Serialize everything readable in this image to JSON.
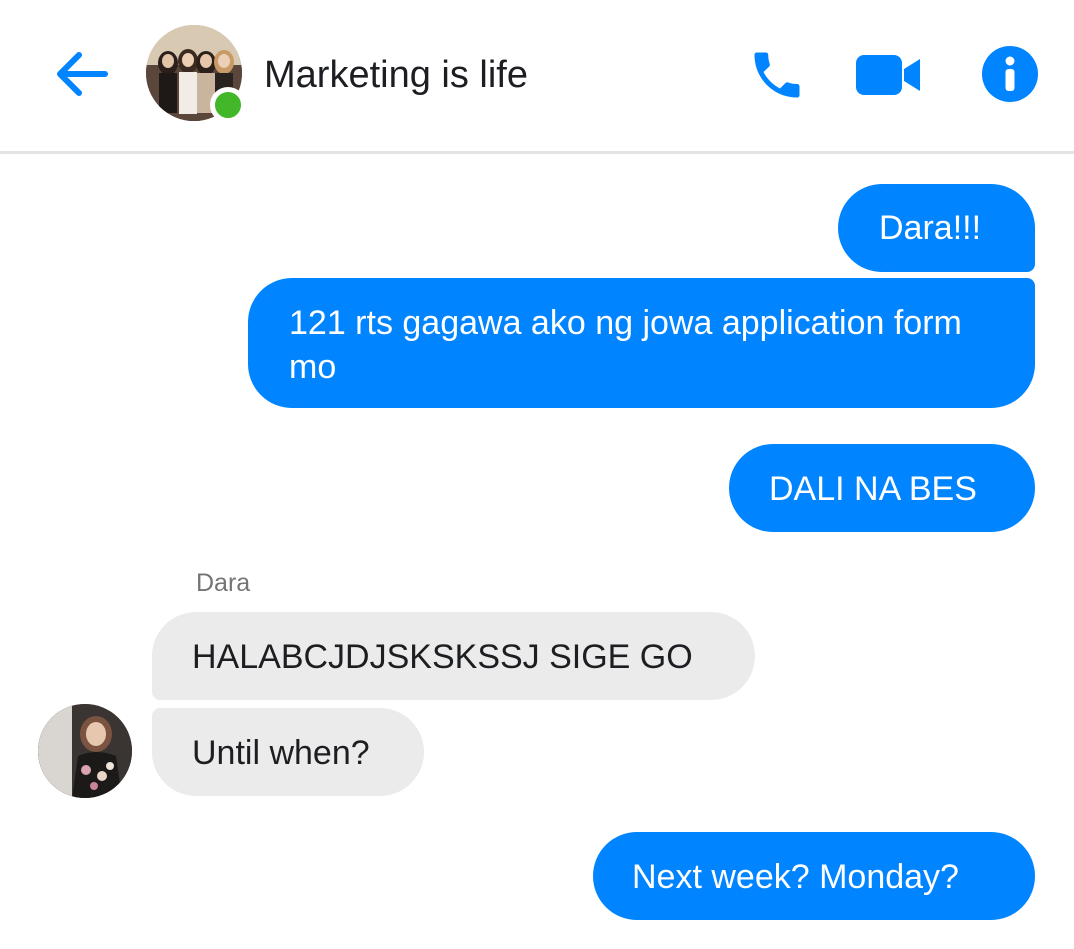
{
  "header": {
    "back_icon": "arrow-left-icon",
    "title": "Marketing is life",
    "online": true,
    "call_icon": "phone-icon",
    "video_icon": "video-camera-icon",
    "info_icon": "info-icon",
    "accent_color": "#0084ff",
    "presence_color": "#42b72a"
  },
  "messages": [
    {
      "direction": "outgoing",
      "text": "Dara!!!"
    },
    {
      "direction": "outgoing",
      "text": "121 rts gagawa ako ng jowa application form mo"
    },
    {
      "direction": "outgoing",
      "text": "DALI NA BES"
    },
    {
      "direction": "incoming",
      "sender": "Dara",
      "text": "HALABCJDJSKSKSSJ SIGE GO"
    },
    {
      "direction": "incoming",
      "sender": "Dara",
      "text": "Until when?"
    },
    {
      "direction": "outgoing",
      "text": "Next week? Monday?"
    }
  ],
  "colors": {
    "outgoing_bubble": "#0084ff",
    "incoming_bubble": "#ebebeb"
  }
}
